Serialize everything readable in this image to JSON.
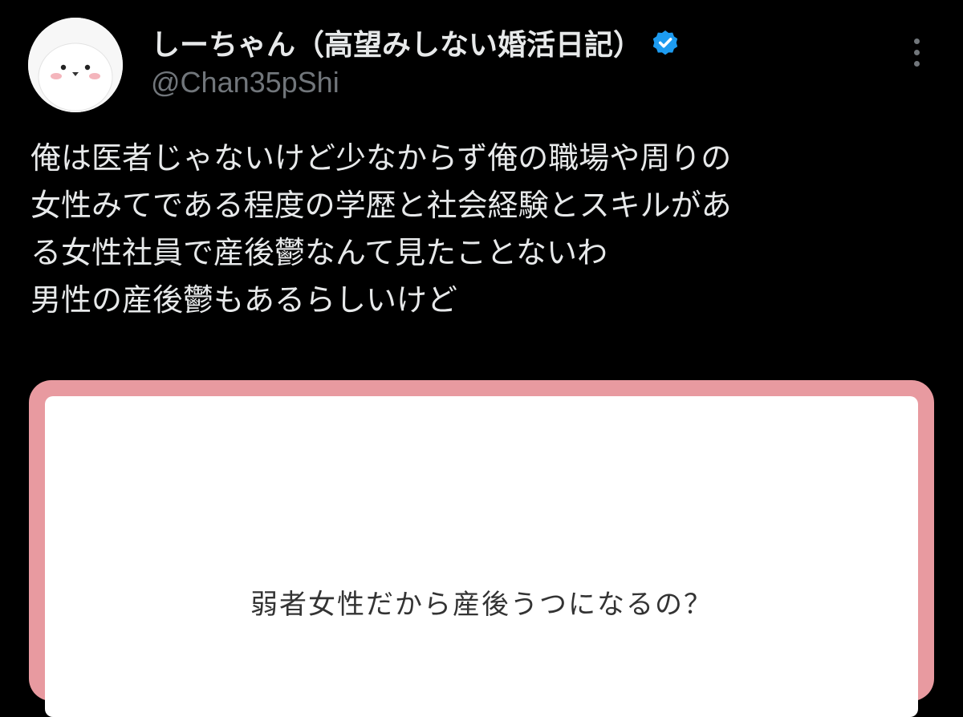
{
  "author": {
    "display_name": "しーちゃん（高望みしない婚活日記）",
    "handle": "@Chan35pShi",
    "avatar_icon": "white-bird-avatar-icon",
    "verified_icon": "verified-badge-icon",
    "verified_color": "#1d9bf0"
  },
  "actions": {
    "more_icon": "more-vertical-icon"
  },
  "tweet": {
    "lines": [
      "俺は医者じゃないけど少なからず俺の職場や周りの",
      "女性みてである程度の学歴と社会経験とスキルがあ",
      "る女性社員で産後鬱なんて見たことないわ",
      "男性の産後鬱もあるらしいけど"
    ]
  },
  "media": {
    "text": "弱者女性だから産後うつになるの？",
    "border_color": "#e89aa0"
  },
  "colors": {
    "background": "#000000",
    "primary_text": "#e7e9ea",
    "secondary_text": "#71767b"
  }
}
